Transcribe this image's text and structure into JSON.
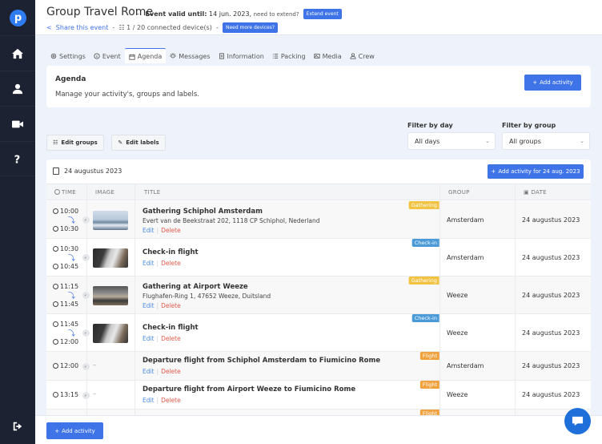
{
  "header": {
    "title": "Group Travel Rome",
    "separator": "-",
    "valid_label": "Event valid until:",
    "valid_date": "14 jun. 2023,",
    "extend_prompt": "need to extend?",
    "extend_button": "Extend event",
    "share_link": "Share this event",
    "devices": "1 / 20 connected device(s)",
    "more_devices_button": "Need more devices?"
  },
  "sidebar": {
    "logo": "p",
    "items": [
      "home-icon",
      "user-icon",
      "video-icon",
      "help-icon"
    ],
    "logout": "logout-icon"
  },
  "tabs": [
    {
      "label": "Settings",
      "icon": "gear-icon"
    },
    {
      "label": "Event",
      "icon": "info-icon"
    },
    {
      "label": "Agenda",
      "icon": "calendar-icon",
      "active": true
    },
    {
      "label": "Messages",
      "icon": "bulb-icon"
    },
    {
      "label": "Information",
      "icon": "document-icon"
    },
    {
      "label": "Packing",
      "icon": "list-icon"
    },
    {
      "label": "Media",
      "icon": "image-icon"
    },
    {
      "label": "Crew",
      "icon": "person-icon"
    }
  ],
  "agenda": {
    "title": "Agenda",
    "description": "Manage your activity's, groups and labels.",
    "add_button": "Add activity"
  },
  "toolbar": {
    "edit_groups": "Edit groups",
    "edit_labels": "Edit labels",
    "filter_day_label": "Filter by day",
    "filter_day_value": "All days",
    "filter_group_label": "Filter by group",
    "filter_group_value": "All groups"
  },
  "day": {
    "title": "24 augustus 2023",
    "add_button": "Add activity for 24 aug. 2023",
    "columns": {
      "time": "TIME",
      "image": "IMAGE",
      "title": "TITLE",
      "group": "GROUP",
      "date": "DATE"
    },
    "rows": [
      {
        "start": "10:00",
        "end": "10:30",
        "image": "airport",
        "title": "Gathering Schiphol Amsterdam",
        "address": "Evert van de Beekstraat 202, 1118 CP Schiphol, Nederland",
        "label": "Gathering",
        "group": "Amsterdam",
        "date": "24 augustus 2023"
      },
      {
        "start": "10:30",
        "end": "10:45",
        "image": "checkin",
        "title": "Check-in flight",
        "address": "",
        "label": "Check-in",
        "group": "Amsterdam",
        "date": "24 augustus 2023"
      },
      {
        "start": "11:15",
        "end": "11:45",
        "image": "weeze",
        "title": "Gathering at Airport Weeze",
        "address": "Flughafen-Ring 1, 47652 Weeze, Duitsland",
        "label": "Gathering",
        "group": "Weeze",
        "date": "24 augustus 2023"
      },
      {
        "start": "11:45",
        "end": "12:00",
        "image": "checkin",
        "title": "Check-in flight",
        "address": "",
        "label": "Check-in",
        "group": "Weeze",
        "date": "24 augustus 2023"
      },
      {
        "start": "12:00",
        "end": "",
        "image": "",
        "title": "Departure flight from Schiphol Amsterdam to Fiumicino Rome",
        "address": "",
        "label": "Flight",
        "group": "Amsterdam",
        "date": "24 augustus 2023"
      },
      {
        "start": "13:15",
        "end": "",
        "image": "",
        "title": "Departure flight from Airport Weeze to Fiumicino Rome",
        "address": "",
        "label": "Flight",
        "group": "Weeze",
        "date": "24 augustus 2023"
      },
      {
        "start": "",
        "end": "",
        "image": "",
        "title": "",
        "address": "",
        "label": "Flight",
        "group": "",
        "date": ""
      }
    ],
    "actions": {
      "edit": "Edit",
      "delete": "Delete",
      "sep": "|"
    },
    "no_image": "–"
  },
  "footer": {
    "add_button": "Add activity"
  },
  "colors": {
    "primary": "#3f73e8",
    "sidebar": "#1c2232",
    "label_gathering": "#f2c343",
    "label_checkin": "#4a9ad8",
    "label_flight": "#efa23e",
    "chat": "#1e6fd9"
  }
}
